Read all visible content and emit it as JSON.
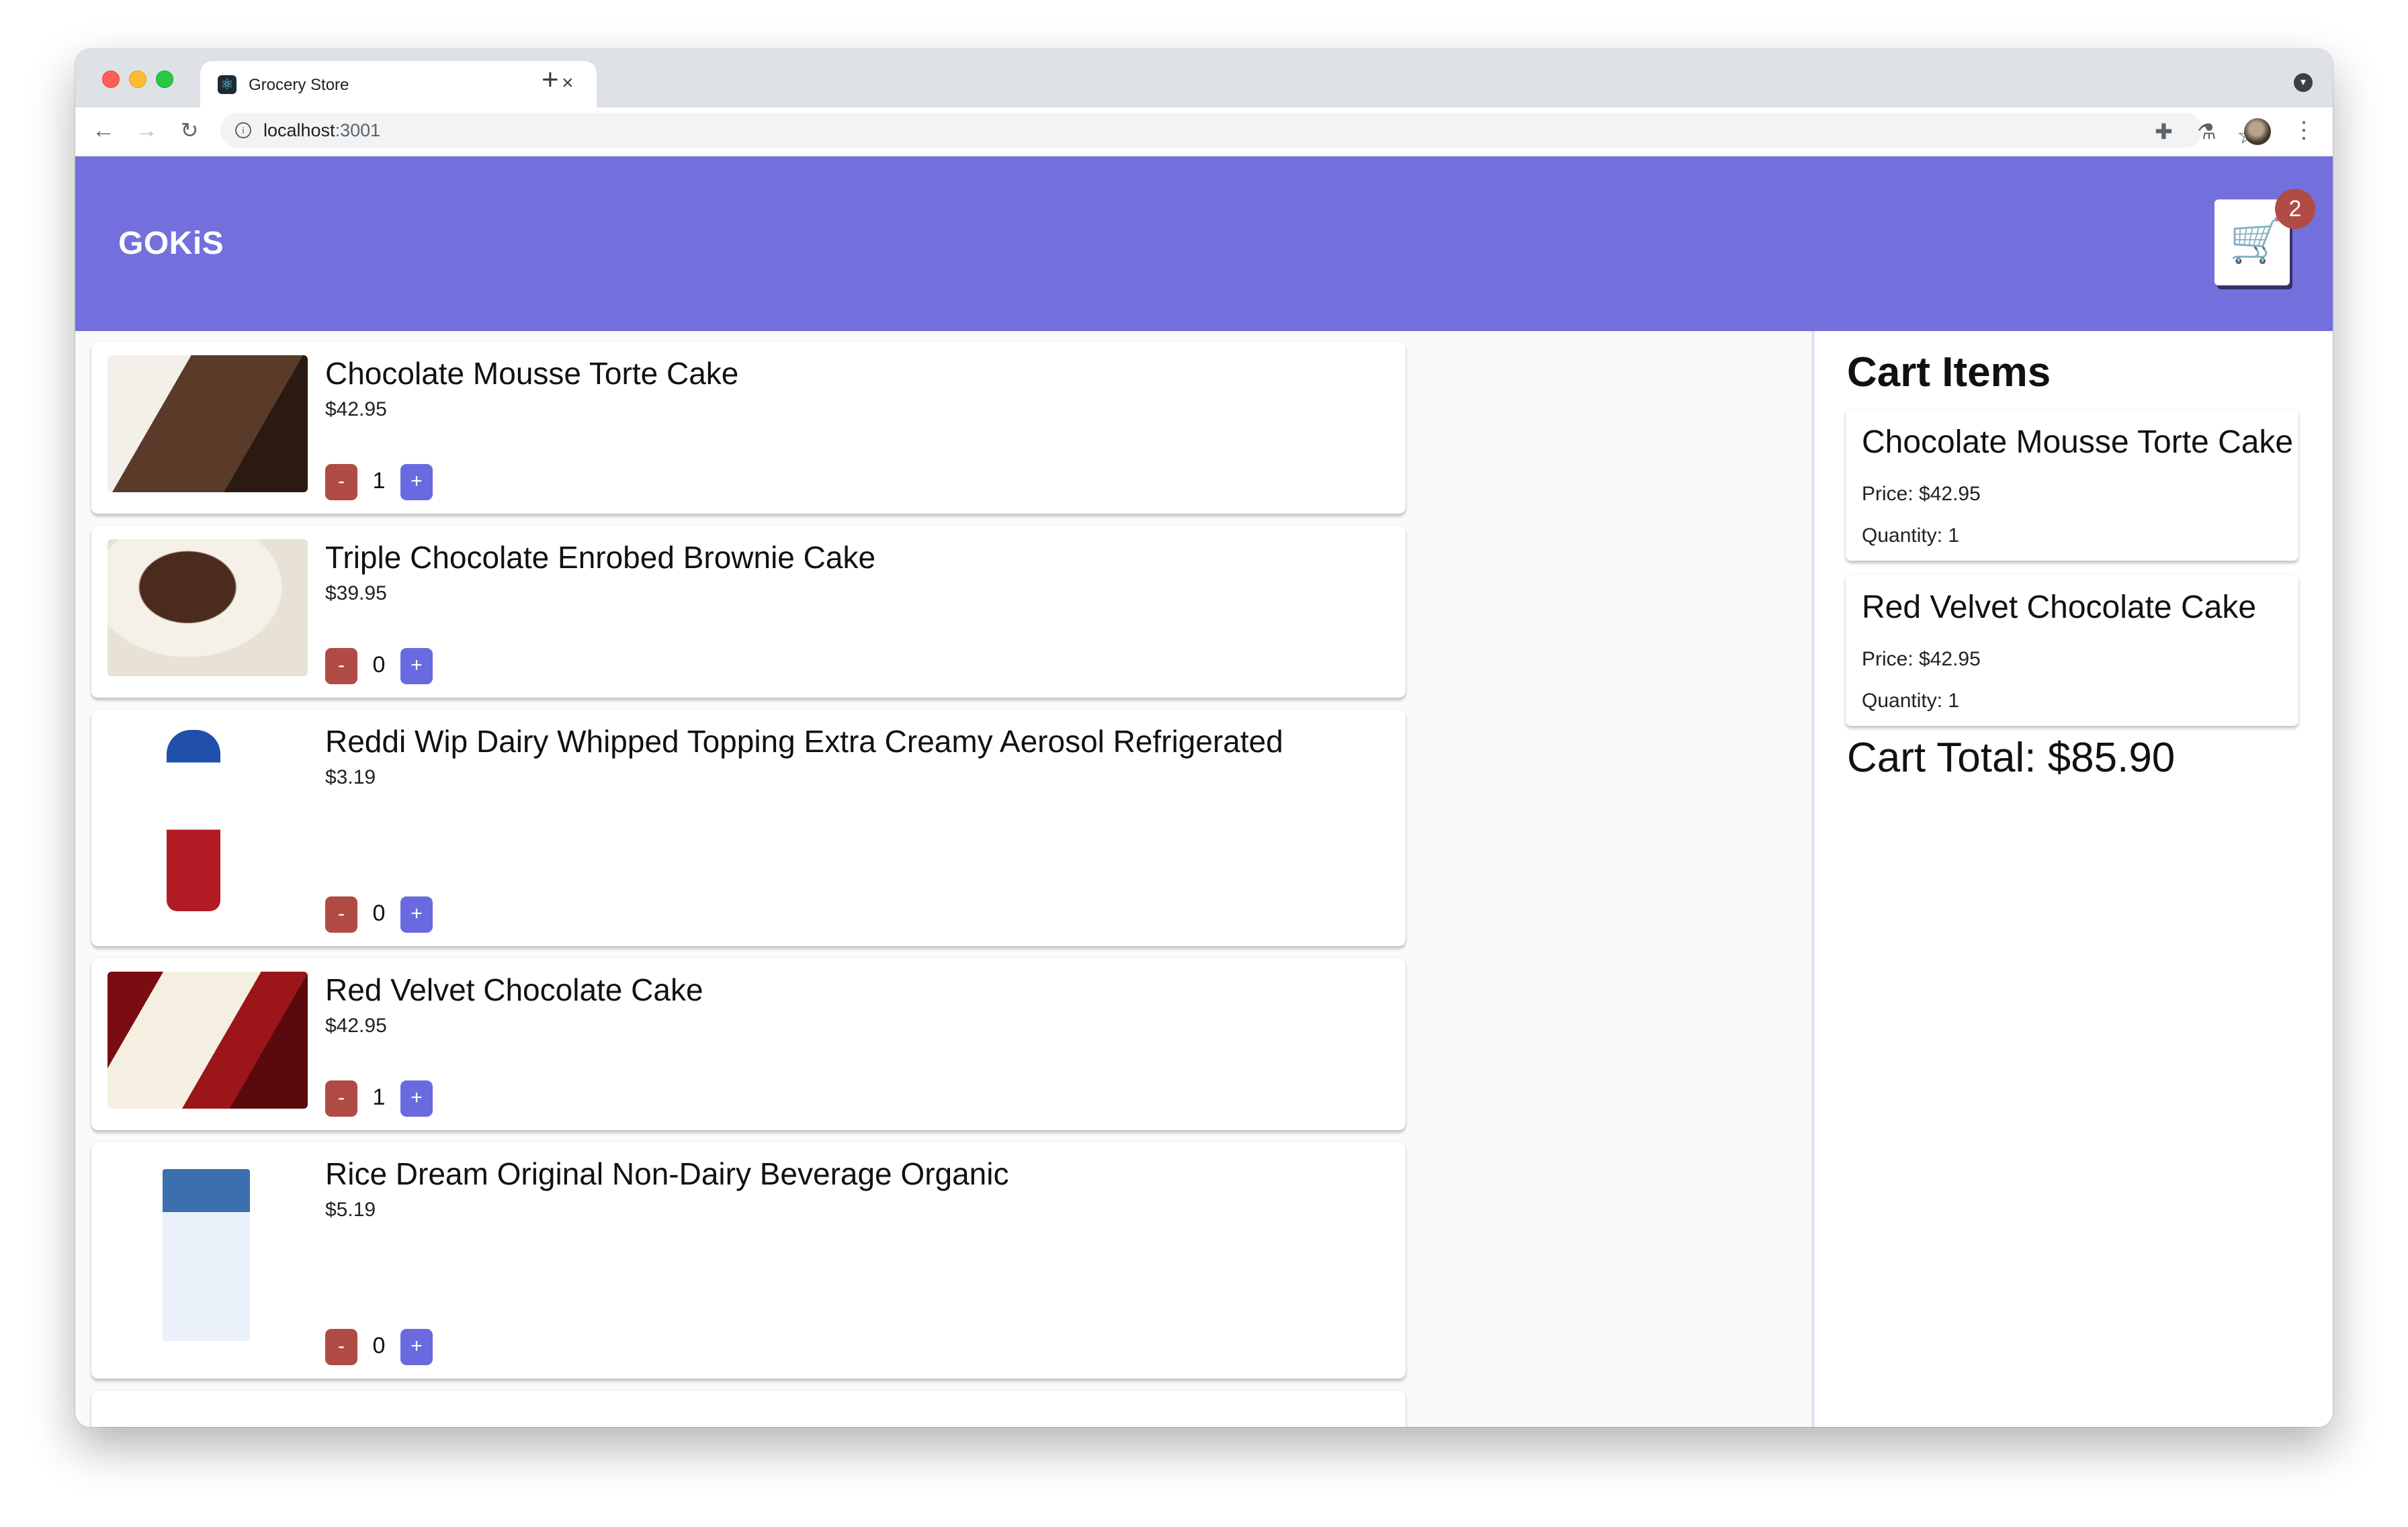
{
  "browser": {
    "tab_title": "Grocery Store",
    "tab_close": "×",
    "new_tab": "+",
    "url_host": "localhost",
    "url_port": ":3001",
    "icons": {
      "back": "arrow-left-icon",
      "forward": "arrow-right-icon",
      "reload": "reload-icon",
      "info": "info-icon",
      "star": "star-icon",
      "extensions": "puzzle-icon",
      "labs": "flask-icon",
      "menu": "kebab-menu-icon"
    }
  },
  "header": {
    "brand": "GOKiS",
    "cart_badge": "2",
    "accent_color": "#7370dd",
    "badge_color": "#b04b45"
  },
  "products": [
    {
      "name": "Chocolate Mousse Torte Cake",
      "price": "$42.95",
      "qty": "1"
    },
    {
      "name": "Triple Chocolate Enrobed Brownie Cake",
      "price": "$39.95",
      "qty": "0"
    },
    {
      "name": "Reddi Wip Dairy Whipped Topping Extra Creamy Aerosol Refrigerated",
      "price": "$3.19",
      "qty": "0"
    },
    {
      "name": "Red Velvet Chocolate Cake",
      "price": "$42.95",
      "qty": "1"
    },
    {
      "name": "Rice Dream Original Non-Dairy Beverage Organic",
      "price": "$5.19",
      "qty": "0"
    }
  ],
  "buttons": {
    "minus": "-",
    "plus": "+"
  },
  "cart": {
    "heading": "Cart Items",
    "items": [
      {
        "name": "Chocolate Mousse Torte Cake",
        "price": "Price: $42.95",
        "qty": "Quantity: 1"
      },
      {
        "name": "Red Velvet Chocolate Cake",
        "price": "Price: $42.95",
        "qty": "Quantity: 1"
      }
    ],
    "total": "Cart Total: $85.90"
  }
}
